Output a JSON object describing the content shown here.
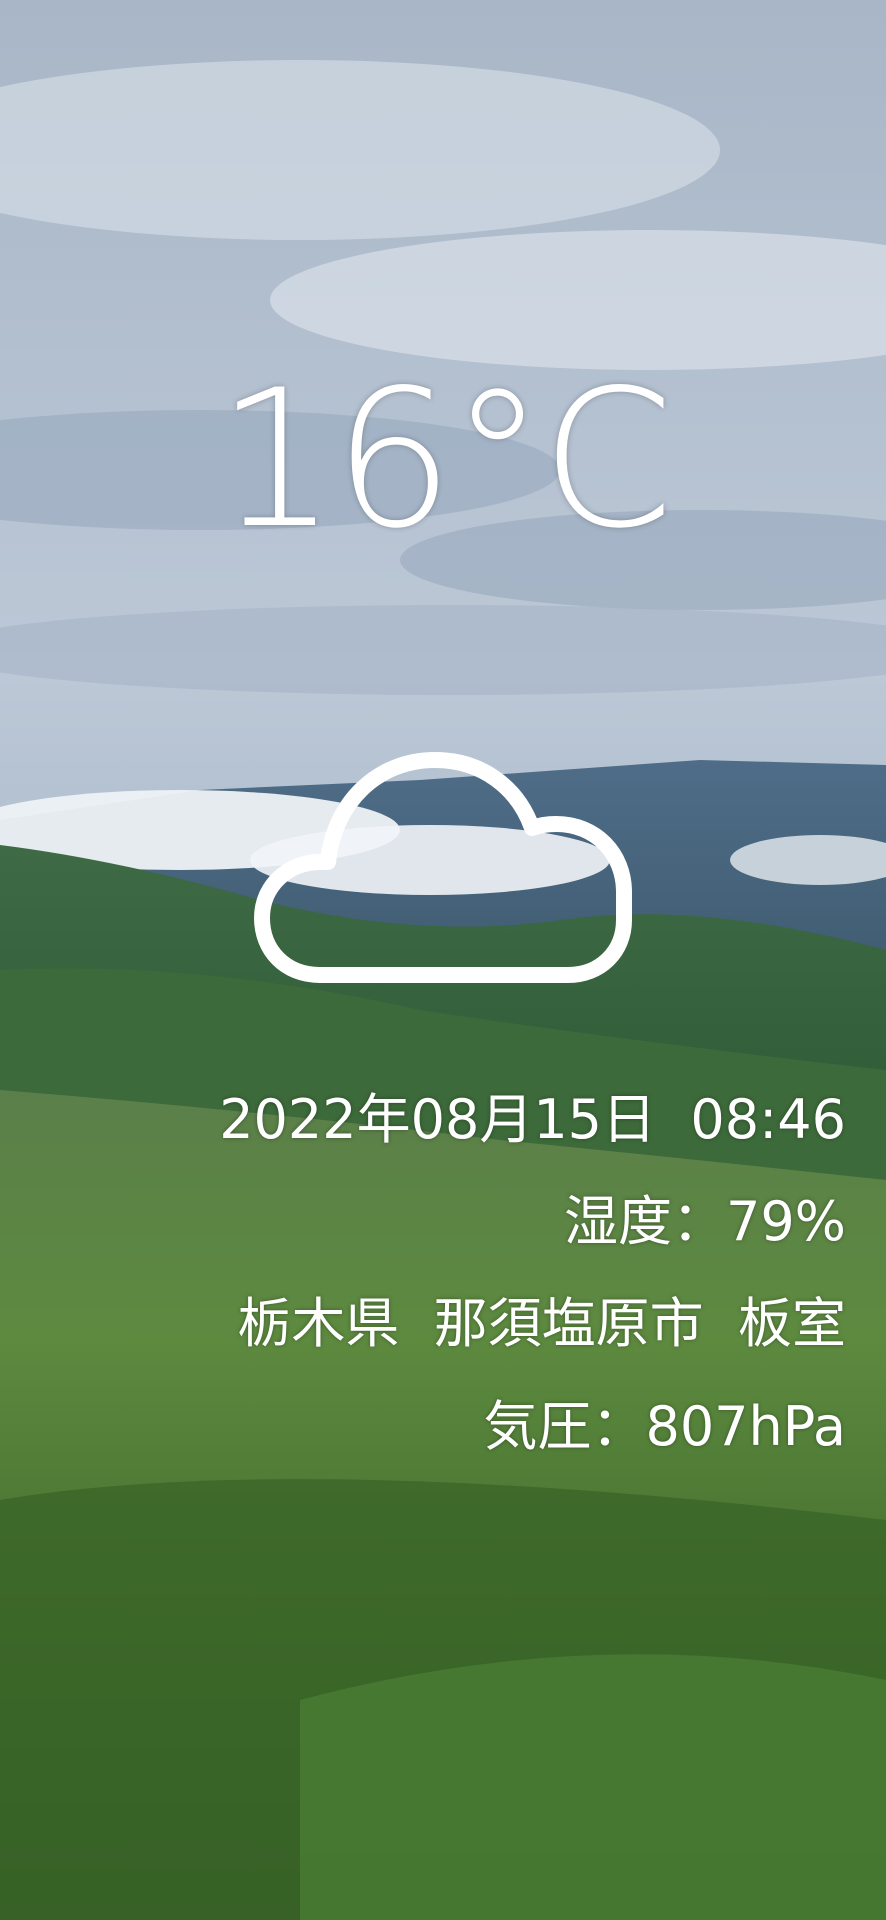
{
  "weather": {
    "temperature": "16°C",
    "condition_icon": "cloud-icon",
    "datetime": "2022年08月15日  08:46",
    "humidity": "湿度：79%",
    "location": "栃木県  那須塩原市  板室",
    "pressure": "気圧：807hPa"
  },
  "colors": {
    "text": "#ffffff",
    "sky_top": "#aab7c8",
    "sky_bottom": "#cfd9e4",
    "mountain": "#4e6e88",
    "grass": "#4f7a38"
  }
}
